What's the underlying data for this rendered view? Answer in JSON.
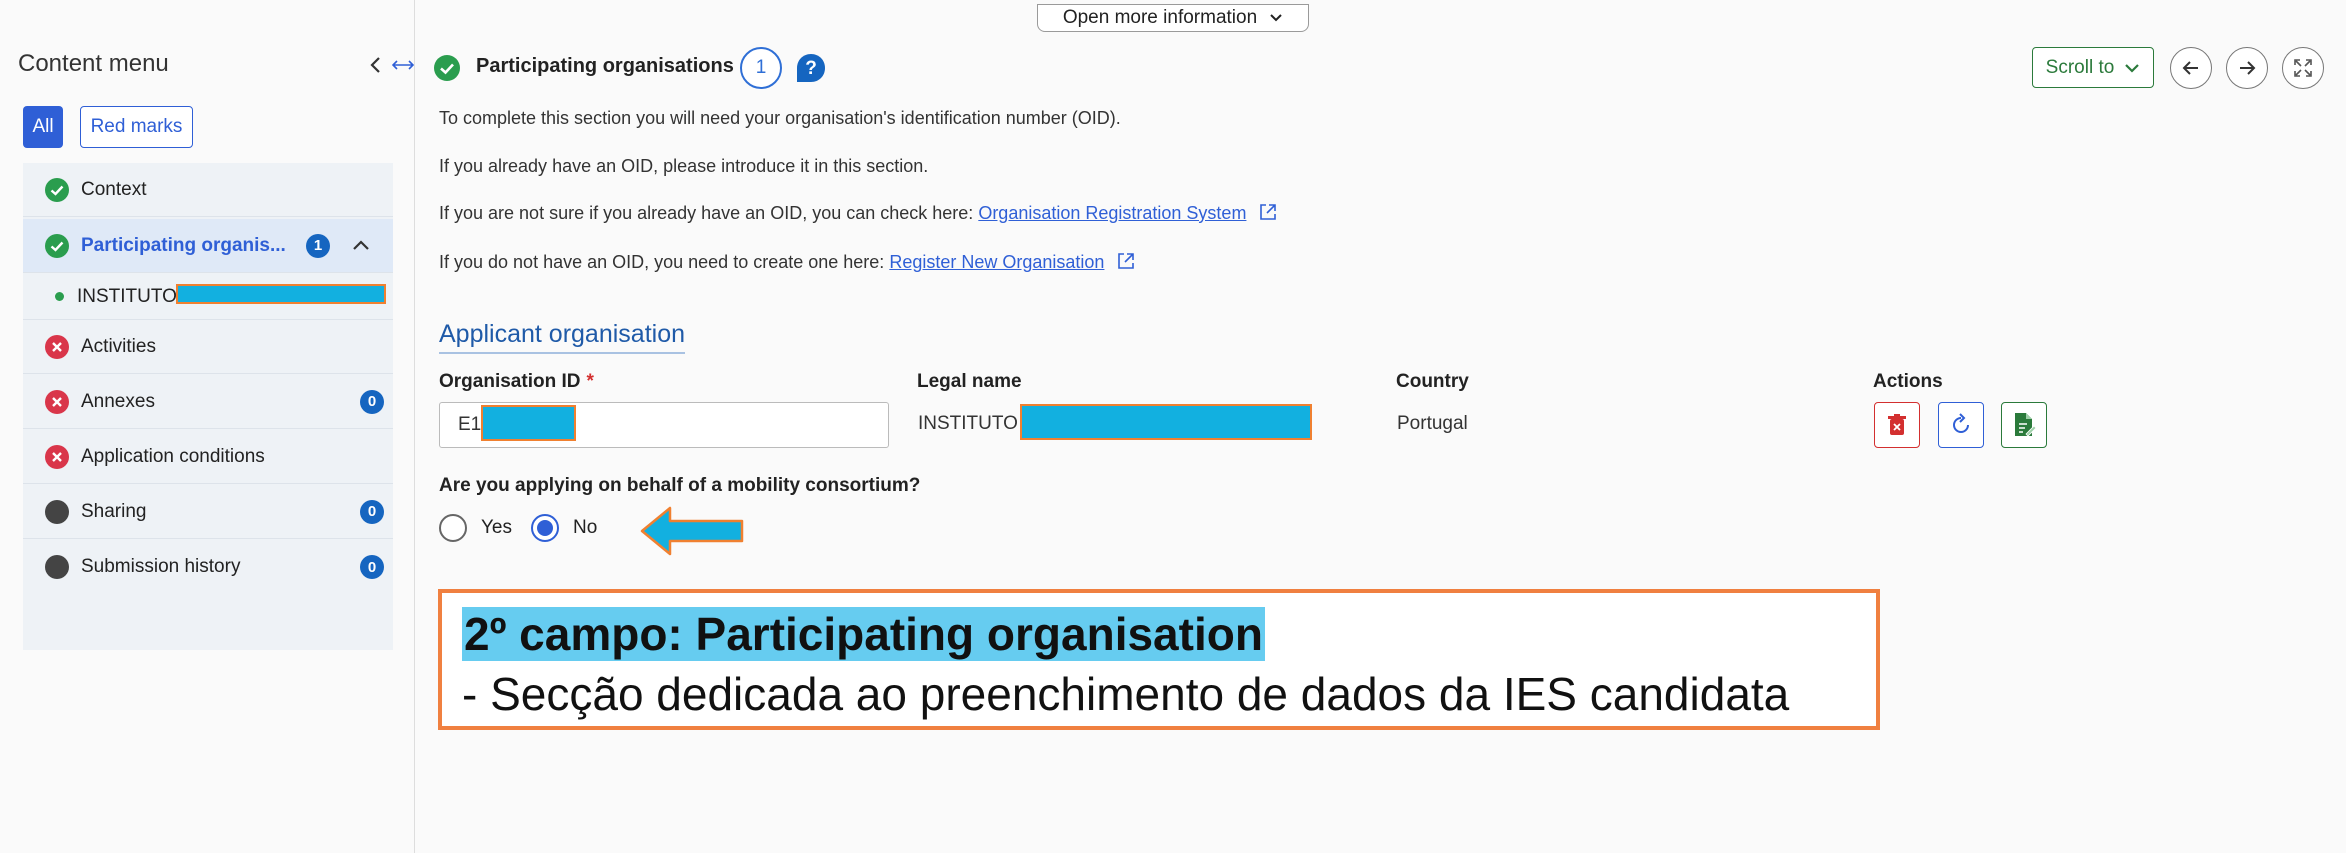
{
  "top_bar": {
    "more_info_label": "Open more information"
  },
  "sidebar": {
    "title": "Content menu",
    "filters": {
      "all": "All",
      "red_marks": "Red marks"
    },
    "items": [
      {
        "label": "Context",
        "status": "complete"
      },
      {
        "label": "Participating organis...",
        "status": "complete",
        "count": "1",
        "active": true
      },
      {
        "label": "Activities",
        "status": "error"
      },
      {
        "label": "Annexes",
        "status": "error",
        "count": "0"
      },
      {
        "label": "Application conditions",
        "status": "error"
      },
      {
        "label": "Sharing",
        "status": "neutral",
        "count": "0"
      },
      {
        "label": "Submission history",
        "status": "neutral",
        "count": "0"
      }
    ],
    "sub_item": {
      "label": "INSTITUTO"
    }
  },
  "header": {
    "title": "Participating organisations",
    "count": "1",
    "scroll_to": "Scroll to"
  },
  "intro": {
    "line1": "To complete this section you will need your organisation's identification number (OID).",
    "line2": "If you already have an OID, please introduce it in this section.",
    "line3_text": "If you are not sure if you already have an OID, you can check here:",
    "line3_link": "Organisation Registration System",
    "line4_text": "If you do not have an OID, you need to create one here:",
    "line4_link": "Register New Organisation"
  },
  "applicant": {
    "section_title": "Applicant organisation",
    "columns": {
      "oid": "Organisation ID",
      "required": "*",
      "legal_name": "Legal name",
      "country": "Country",
      "actions": "Actions"
    },
    "oid_value": "E1",
    "legal_name_value": "INSTITUTO",
    "country_value": "Portugal"
  },
  "consortium": {
    "question": "Are you applying on behalf of a mobility consortium?",
    "options": [
      {
        "label": "Yes",
        "selected": false
      },
      {
        "label": "No",
        "selected": true
      }
    ]
  },
  "callout": {
    "title": "2º campo: Participating organisation",
    "description": "- Secção dedicada ao preenchimento de dados da IES candidata"
  },
  "colors": {
    "primary": "#2f5fd6",
    "success": "#2a9d4e",
    "error": "#d9364a",
    "neutral": "#444444",
    "highlight": "#12b0e0",
    "callout_border": "#f08040"
  }
}
